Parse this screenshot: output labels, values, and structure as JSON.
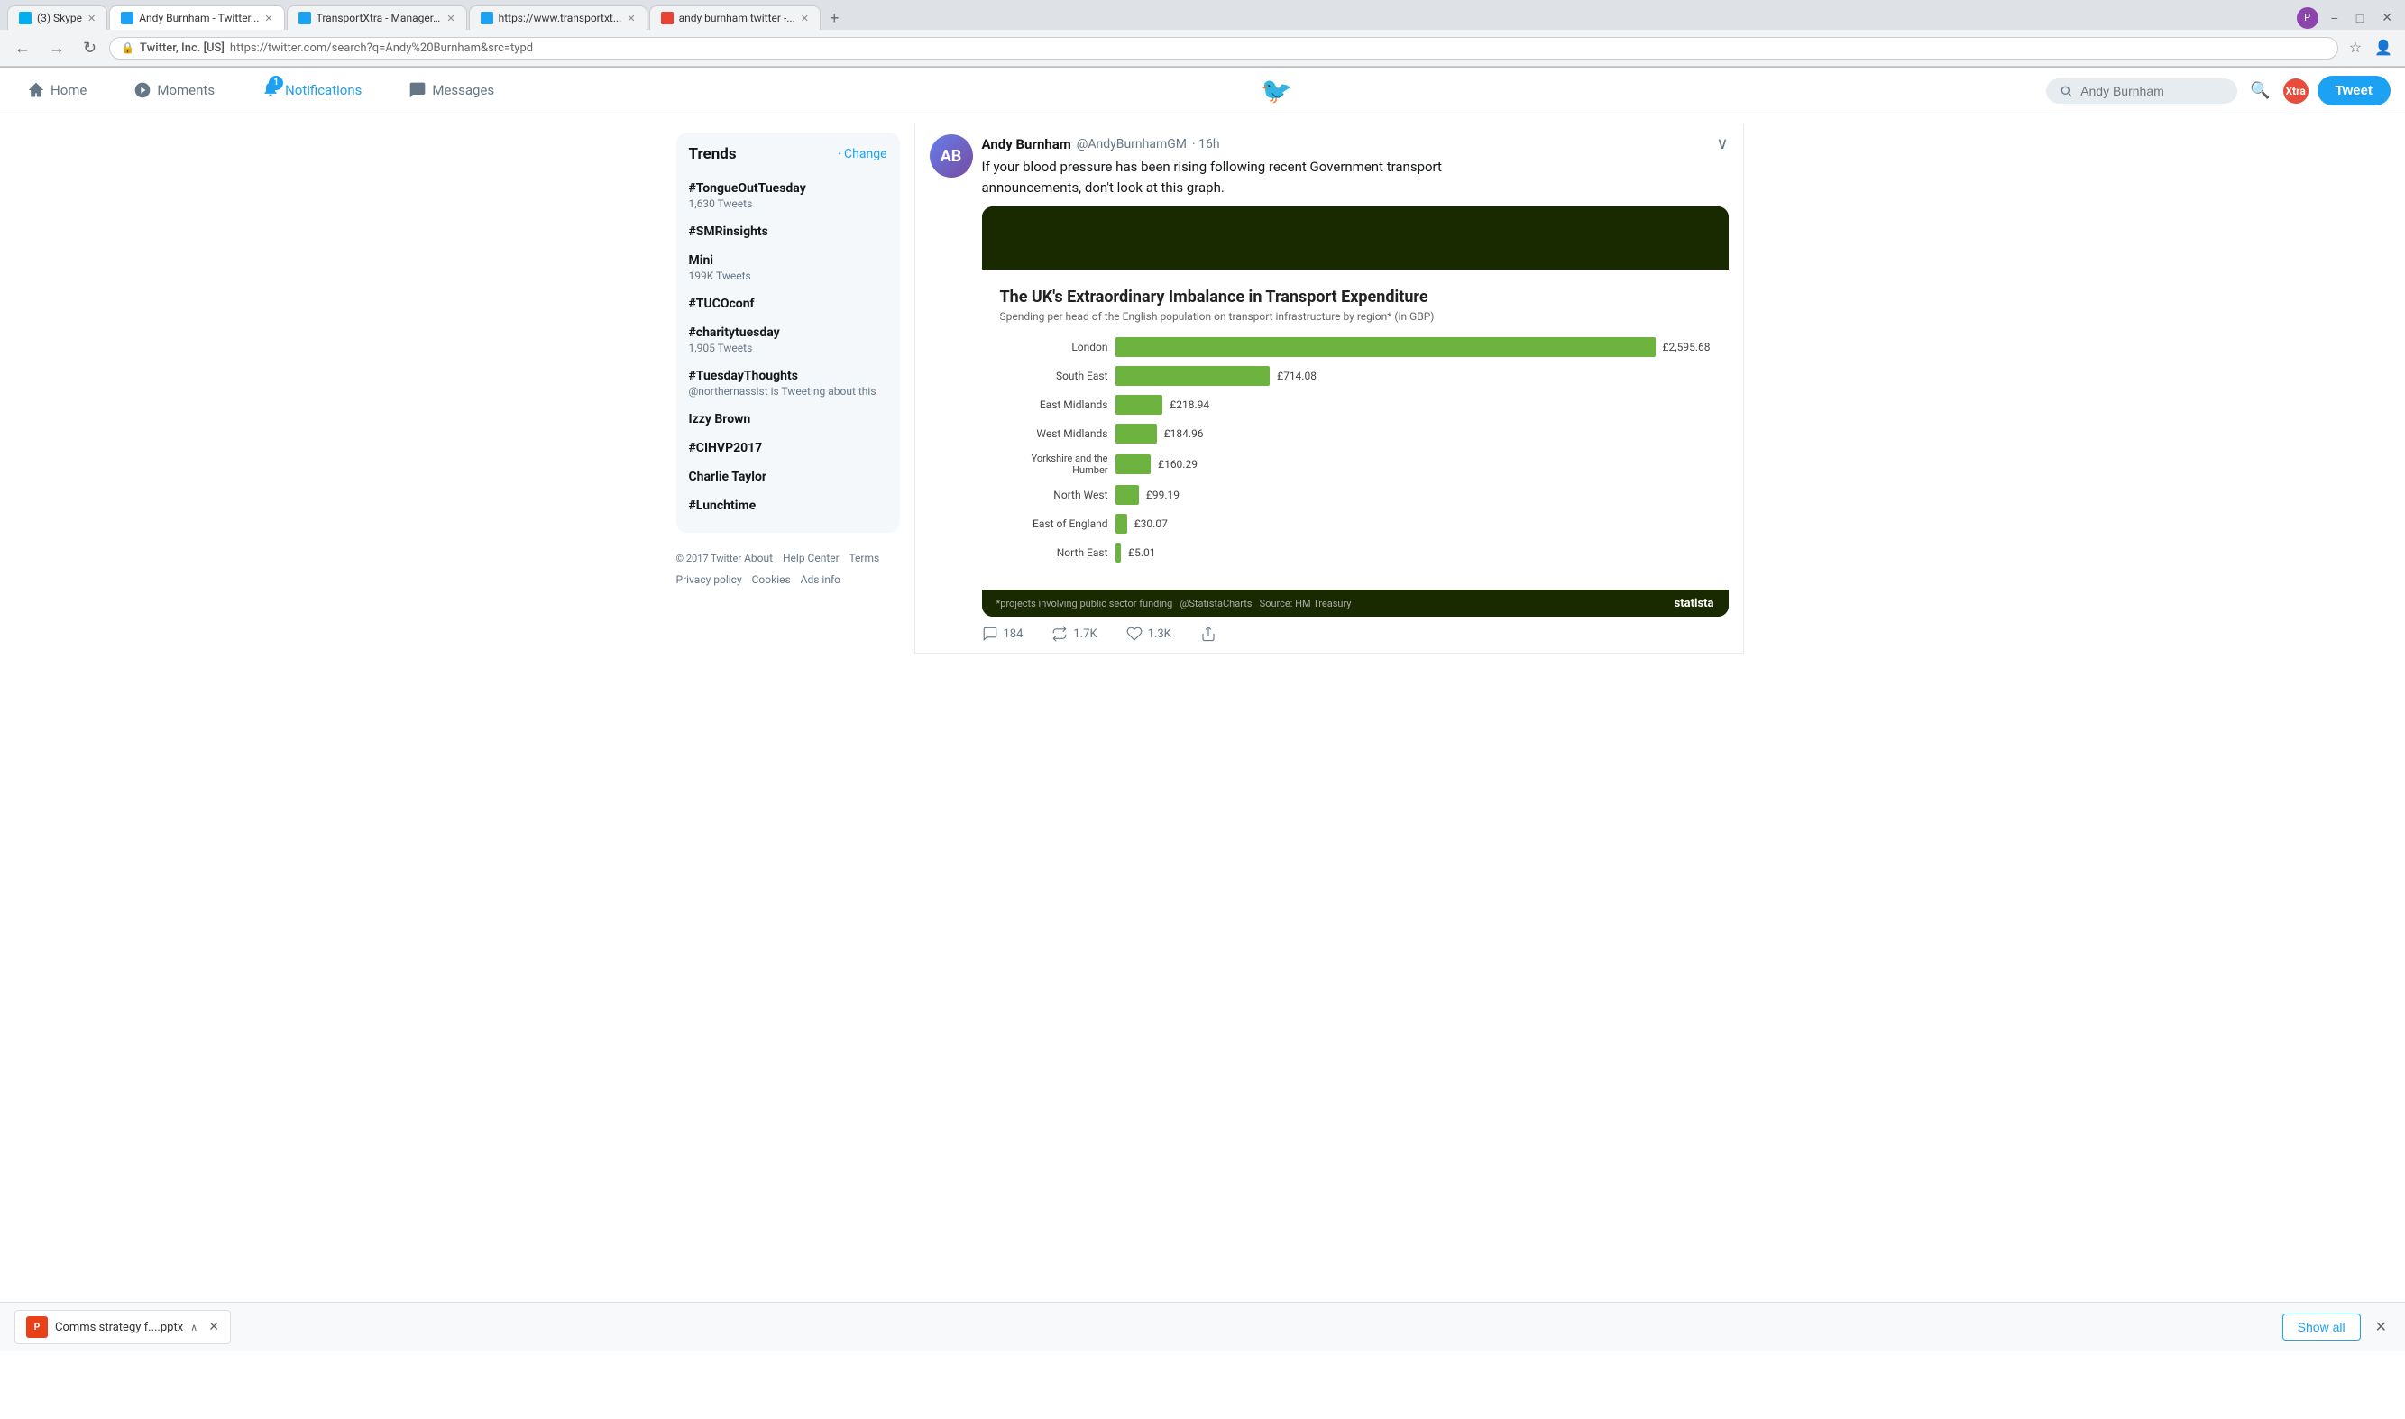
{
  "browser": {
    "tabs": [
      {
        "id": "tab1",
        "favicon_color": "#00aff0",
        "title": "(3) Skype",
        "active": false
      },
      {
        "id": "tab2",
        "favicon_color": "#1da1f2",
        "title": "Andy Burnham - Twitter...",
        "active": true
      },
      {
        "id": "tab3",
        "favicon_color": "#1da1f2",
        "title": "TransportXtra - Manager...",
        "active": false
      },
      {
        "id": "tab4",
        "favicon_color": "#4285f4",
        "title": "https://www.transportxt...",
        "active": false
      },
      {
        "id": "tab5",
        "favicon_color": "#ea4335",
        "title": "andy burnham twitter -...",
        "active": false
      }
    ],
    "url_lock_label": "Twitter, Inc. [US]",
    "url_path": "https://twitter.com/search?q=Andy%20Burnham&src=typd"
  },
  "nav": {
    "home_label": "Home",
    "moments_label": "Moments",
    "notifications_label": "Notifications",
    "notifications_badge": "1",
    "messages_label": "Messages",
    "search_placeholder": "Andy Burnham",
    "tweet_button_label": "Tweet",
    "xtra_label": "Xtra"
  },
  "sidebar": {
    "trends_title": "Trends",
    "change_label": "· Change",
    "items": [
      {
        "name": "#TongueOutTuesday",
        "count": "1,630 Tweets"
      },
      {
        "name": "#SMRinsights",
        "count": ""
      },
      {
        "name": "Mini",
        "count": "199K Tweets"
      },
      {
        "name": "#TUCOconf",
        "count": ""
      },
      {
        "name": "#charitytuesday",
        "count": "1,905 Tweets"
      },
      {
        "name": "#TuesdayThoughts",
        "count": "@northernassist is Tweeting about this"
      },
      {
        "name": "Izzy Brown",
        "count": ""
      },
      {
        "name": "#CIHVP2017",
        "count": ""
      },
      {
        "name": "Charlie Taylor",
        "count": ""
      },
      {
        "name": "#Lunchtime",
        "count": ""
      }
    ],
    "footer": {
      "copyright": "© 2017 Twitter",
      "links": [
        "About",
        "Help Center",
        "Terms",
        "Privacy policy",
        "Cookies",
        "Ads info"
      ]
    }
  },
  "tweet": {
    "author_name": "Andy Burnham",
    "author_handle": "@AndyBurnhamGM",
    "time": "· 16h",
    "text_line1": "If your blood pressure has been rising following recent Government transport",
    "text_line2": "announcements, don't look at this graph.",
    "actions": {
      "reply_count": "184",
      "retweet_count": "1.7K",
      "like_count": "1.3K"
    }
  },
  "chart": {
    "title": "The UK's Extraordinary Imbalance in Transport Expenditure",
    "subtitle": "Spending per head of the English population on transport infrastructure by region* (in GBP)",
    "bars": [
      {
        "label": "London",
        "value": "£2,595.68",
        "width_pct": 95
      },
      {
        "label": "South East",
        "value": "£714.08",
        "width_pct": 26
      },
      {
        "label": "East Midlands",
        "value": "£218.94",
        "width_pct": 8
      },
      {
        "label": "West Midlands",
        "value": "£184.96",
        "width_pct": 7
      },
      {
        "label": "Yorkshire and the Humber",
        "value": "£160.29",
        "width_pct": 6
      },
      {
        "label": "North West",
        "value": "£99.19",
        "width_pct": 4
      },
      {
        "label": "East of England",
        "value": "£30.07",
        "width_pct": 2
      },
      {
        "label": "North East",
        "value": "£5.01",
        "width_pct": 1
      }
    ],
    "source_note": "*projects involving public sector funding",
    "source": "@StatistaCharts   Source: HM Treasury",
    "brand": "statista"
  },
  "bottom_bar": {
    "file_name": "Comms strategy f....pptx",
    "show_all_label": "Show all"
  },
  "colors": {
    "twitter_blue": "#1da1f2",
    "bar_green": "#6db33f",
    "chart_dark": "#1a2a00"
  }
}
